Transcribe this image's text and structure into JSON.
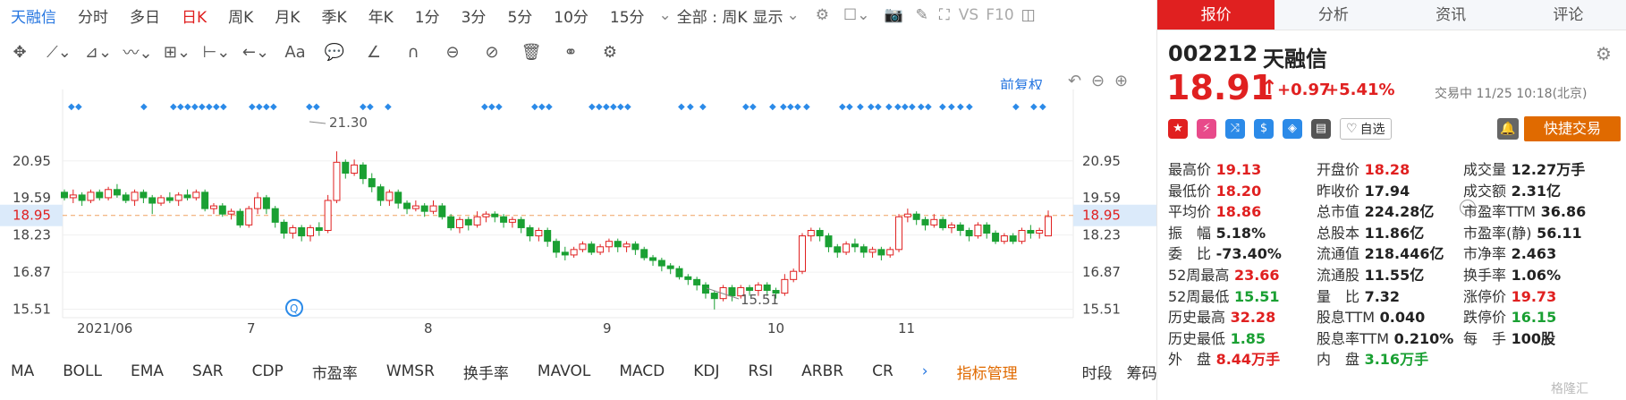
{
  "toolbar": {
    "name": "天融信",
    "periods": [
      "分时",
      "多日",
      "日K",
      "周K",
      "月K",
      "季K",
      "年K",
      "1分",
      "3分",
      "5分",
      "10分",
      "15分"
    ],
    "active": "日K",
    "range": "全部 : 周K",
    "display": "显示",
    "vs": "VS",
    "f10": "F10"
  },
  "chart": {
    "restore": "前复权",
    "y_ticks": [
      "20.95",
      "19.59",
      "18.95",
      "18.23",
      "16.87",
      "15.51"
    ],
    "x_ticks": [
      "2021/06",
      "7",
      "8",
      "9",
      "10",
      "11"
    ],
    "high_label": "21.30",
    "low_label": "15.51",
    "current_price": "18.95",
    "marker_icon": "Q"
  },
  "indicators": [
    "MA",
    "BOLL",
    "EMA",
    "SAR",
    "CDP",
    "市盈率",
    "WMSR",
    "换手率",
    "MAVOL",
    "MACD",
    "KDJ",
    "RSI",
    "ARBR",
    "CR"
  ],
  "ind_manage": "指标管理",
  "bottom_right": [
    "时段",
    "筹码"
  ],
  "tabs": [
    "报价",
    "分析",
    "资讯",
    "评论"
  ],
  "quote": {
    "code": "002212",
    "name": "天融信",
    "price": "18.91",
    "change": "+0.97",
    "pct": "+5.41%",
    "status": "交易中 11/25 10:18(北京)",
    "watch": "自选",
    "trade": "快捷交易"
  },
  "stats": [
    [
      [
        "最高价",
        "19.13",
        "red"
      ],
      [
        "开盘价",
        "18.28",
        "red"
      ],
      [
        "成交量",
        "12.27万手",
        "blk"
      ]
    ],
    [
      [
        "最低价",
        "18.20",
        "red"
      ],
      [
        "昨收价",
        "17.94",
        "blk"
      ],
      [
        "成交额",
        "2.31亿",
        "blk"
      ]
    ],
    [
      [
        "平均价",
        "18.86",
        "red"
      ],
      [
        "总市值",
        "224.28亿",
        "blk"
      ],
      [
        "市盈率TTM",
        "36.86",
        "blk"
      ]
    ],
    [
      [
        "振　幅",
        "5.18%",
        "blk"
      ],
      [
        "总股本",
        "11.86亿",
        "blk"
      ],
      [
        "市盈率(静)",
        "56.11",
        "blk"
      ]
    ],
    [
      [
        "委　比",
        "-73.40%",
        "blk"
      ],
      [
        "流通值",
        "218.446亿",
        "blk"
      ],
      [
        "市净率",
        "2.463",
        "blk"
      ]
    ],
    [
      [
        "52周最高",
        "23.66",
        "red"
      ],
      [
        "流通股",
        "11.55亿",
        "blk"
      ],
      [
        "换手率",
        "1.06%",
        "blk"
      ]
    ],
    [
      [
        "52周最低",
        "15.51",
        "grn"
      ],
      [
        "量　比",
        "7.32",
        "blk"
      ],
      [
        "涨停价",
        "19.73",
        "red"
      ]
    ],
    [
      [
        "历史最高",
        "32.28",
        "red"
      ],
      [
        "股息TTM",
        "0.040",
        "blk"
      ],
      [
        "跌停价",
        "16.15",
        "grn"
      ]
    ],
    [
      [
        "历史最低",
        "1.85",
        "grn"
      ],
      [
        "股息率TTM",
        "0.210%",
        "blk"
      ],
      [
        "每　手",
        "100股",
        "blk"
      ]
    ],
    [
      [
        "外　盘",
        "8.44万手",
        "red"
      ],
      [
        "内　盘",
        "3.16万手",
        "grn"
      ],
      [
        "",
        "",
        " "
      ]
    ]
  ],
  "watermark": "格隆汇",
  "candles": [
    [
      19.8,
      19.6,
      19.9,
      19.5
    ],
    [
      19.6,
      19.7,
      19.9,
      19.4
    ],
    [
      19.7,
      19.5,
      19.8,
      19.3
    ],
    [
      19.5,
      19.8,
      19.9,
      19.4
    ],
    [
      19.8,
      19.6,
      19.9,
      19.5
    ],
    [
      19.6,
      19.9,
      20.0,
      19.5
    ],
    [
      19.9,
      19.7,
      20.1,
      19.6
    ],
    [
      19.7,
      19.5,
      19.8,
      19.4
    ],
    [
      19.5,
      19.8,
      19.9,
      19.3
    ],
    [
      19.8,
      19.6,
      19.9,
      19.4
    ],
    [
      19.6,
      19.4,
      19.7,
      19.0
    ],
    [
      19.4,
      19.6,
      19.7,
      19.3
    ],
    [
      19.6,
      19.5,
      19.8,
      19.4
    ],
    [
      19.5,
      19.7,
      19.8,
      19.3
    ],
    [
      19.7,
      19.6,
      19.9,
      19.5
    ],
    [
      19.6,
      19.8,
      19.9,
      19.5
    ],
    [
      19.8,
      19.2,
      19.9,
      19.1
    ],
    [
      19.2,
      19.3,
      19.4,
      19.0
    ],
    [
      19.3,
      19.0,
      19.4,
      18.9
    ],
    [
      19.0,
      19.1,
      19.2,
      18.8
    ],
    [
      19.1,
      18.6,
      19.2,
      18.5
    ],
    [
      18.6,
      19.2,
      19.3,
      18.5
    ],
    [
      19.2,
      19.6,
      19.8,
      19.0
    ],
    [
      19.6,
      19.2,
      19.7,
      19.0
    ],
    [
      19.2,
      18.7,
      19.3,
      18.5
    ],
    [
      18.7,
      18.3,
      18.8,
      18.1
    ],
    [
      18.3,
      18.5,
      18.6,
      18.1
    ],
    [
      18.5,
      18.2,
      18.6,
      18.0
    ],
    [
      18.2,
      18.5,
      18.6,
      18.0
    ],
    [
      18.5,
      18.4,
      18.7,
      18.2
    ],
    [
      18.4,
      19.5,
      19.7,
      18.3
    ],
    [
      19.5,
      20.9,
      21.3,
      19.4
    ],
    [
      20.9,
      20.5,
      21.0,
      20.3
    ],
    [
      20.5,
      20.8,
      21.0,
      20.4
    ],
    [
      20.8,
      20.3,
      20.9,
      20.1
    ],
    [
      20.3,
      20.0,
      20.5,
      19.8
    ],
    [
      20.0,
      19.5,
      20.1,
      19.3
    ],
    [
      19.5,
      19.8,
      19.9,
      19.3
    ],
    [
      19.8,
      19.4,
      19.9,
      19.2
    ],
    [
      19.4,
      19.2,
      19.5,
      19.0
    ],
    [
      19.2,
      19.3,
      19.5,
      19.1
    ],
    [
      19.3,
      19.1,
      19.4,
      18.9
    ],
    [
      19.1,
      19.3,
      19.5,
      19.0
    ],
    [
      19.3,
      18.9,
      19.4,
      18.8
    ],
    [
      18.9,
      18.5,
      19.0,
      18.4
    ],
    [
      18.5,
      18.8,
      18.9,
      18.3
    ],
    [
      18.8,
      18.6,
      18.9,
      18.4
    ],
    [
      18.6,
      18.9,
      19.1,
      18.5
    ],
    [
      18.9,
      19.0,
      19.1,
      18.7
    ],
    [
      19.0,
      18.9,
      19.1,
      18.7
    ],
    [
      18.9,
      18.7,
      19.0,
      18.5
    ],
    [
      18.7,
      18.8,
      18.9,
      18.5
    ],
    [
      18.8,
      18.5,
      18.9,
      18.3
    ],
    [
      18.5,
      18.2,
      18.6,
      18.0
    ],
    [
      18.2,
      18.4,
      18.5,
      18.0
    ],
    [
      18.4,
      18.0,
      18.5,
      17.8
    ],
    [
      18.0,
      17.6,
      18.1,
      17.4
    ],
    [
      17.6,
      17.5,
      17.8,
      17.3
    ],
    [
      17.5,
      17.7,
      17.8,
      17.4
    ],
    [
      17.7,
      17.9,
      18.0,
      17.6
    ],
    [
      17.9,
      17.6,
      18.0,
      17.5
    ],
    [
      17.6,
      17.8,
      17.9,
      17.5
    ],
    [
      17.8,
      18.0,
      18.1,
      17.6
    ],
    [
      18.0,
      17.8,
      18.1,
      17.6
    ],
    [
      17.8,
      17.9,
      18.0,
      17.6
    ],
    [
      17.9,
      17.7,
      18.0,
      17.5
    ],
    [
      17.7,
      17.4,
      17.8,
      17.3
    ],
    [
      17.4,
      17.3,
      17.5,
      17.1
    ],
    [
      17.3,
      17.1,
      17.4,
      16.9
    ],
    [
      17.1,
      17.0,
      17.2,
      16.8
    ],
    [
      17.0,
      16.7,
      17.1,
      16.6
    ],
    [
      16.7,
      16.6,
      16.8,
      16.4
    ],
    [
      16.6,
      16.4,
      16.7,
      16.2
    ],
    [
      16.4,
      16.1,
      16.5,
      15.9
    ],
    [
      16.1,
      15.9,
      16.2,
      15.5
    ],
    [
      15.9,
      16.3,
      16.4,
      15.8
    ],
    [
      16.3,
      16.0,
      16.4,
      15.8
    ],
    [
      16.0,
      16.3,
      16.4,
      15.9
    ],
    [
      16.3,
      16.2,
      16.4,
      16.0
    ],
    [
      16.2,
      16.4,
      16.5,
      16.0
    ],
    [
      16.4,
      16.2,
      16.5,
      16.0
    ],
    [
      16.2,
      16.1,
      16.3,
      15.9
    ],
    [
      16.1,
      16.6,
      16.8,
      16.0
    ],
    [
      16.6,
      16.9,
      17.0,
      16.5
    ],
    [
      16.9,
      18.2,
      18.3,
      16.8
    ],
    [
      18.2,
      18.4,
      18.5,
      18.0
    ],
    [
      18.4,
      18.2,
      18.5,
      18.0
    ],
    [
      18.2,
      17.8,
      18.3,
      17.6
    ],
    [
      17.8,
      17.6,
      17.9,
      17.4
    ],
    [
      17.6,
      17.9,
      18.0,
      17.5
    ],
    [
      17.9,
      17.8,
      18.1,
      17.6
    ],
    [
      17.8,
      17.6,
      17.9,
      17.4
    ],
    [
      17.6,
      17.7,
      17.8,
      17.4
    ],
    [
      17.7,
      17.5,
      17.8,
      17.3
    ],
    [
      17.5,
      17.7,
      17.8,
      17.4
    ],
    [
      17.7,
      18.9,
      19.0,
      17.6
    ],
    [
      18.9,
      19.0,
      19.2,
      18.7
    ],
    [
      19.0,
      18.8,
      19.1,
      18.6
    ],
    [
      18.8,
      18.6,
      18.9,
      18.4
    ],
    [
      18.6,
      18.8,
      19.0,
      18.5
    ],
    [
      18.8,
      18.5,
      18.9,
      18.4
    ],
    [
      18.5,
      18.6,
      18.7,
      18.3
    ],
    [
      18.6,
      18.4,
      18.7,
      18.2
    ],
    [
      18.4,
      18.2,
      18.5,
      18.0
    ],
    [
      18.2,
      18.6,
      18.7,
      18.1
    ],
    [
      18.6,
      18.3,
      18.7,
      18.1
    ],
    [
      18.3,
      18.0,
      18.4,
      17.9
    ],
    [
      18.0,
      18.2,
      18.3,
      17.9
    ],
    [
      18.2,
      18.0,
      18.3,
      17.9
    ],
    [
      18.0,
      18.4,
      18.5,
      17.9
    ],
    [
      18.4,
      18.3,
      18.6,
      18.1
    ],
    [
      18.3,
      18.4,
      18.5,
      18.1
    ],
    [
      18.2,
      18.91,
      19.13,
      18.2
    ]
  ]
}
